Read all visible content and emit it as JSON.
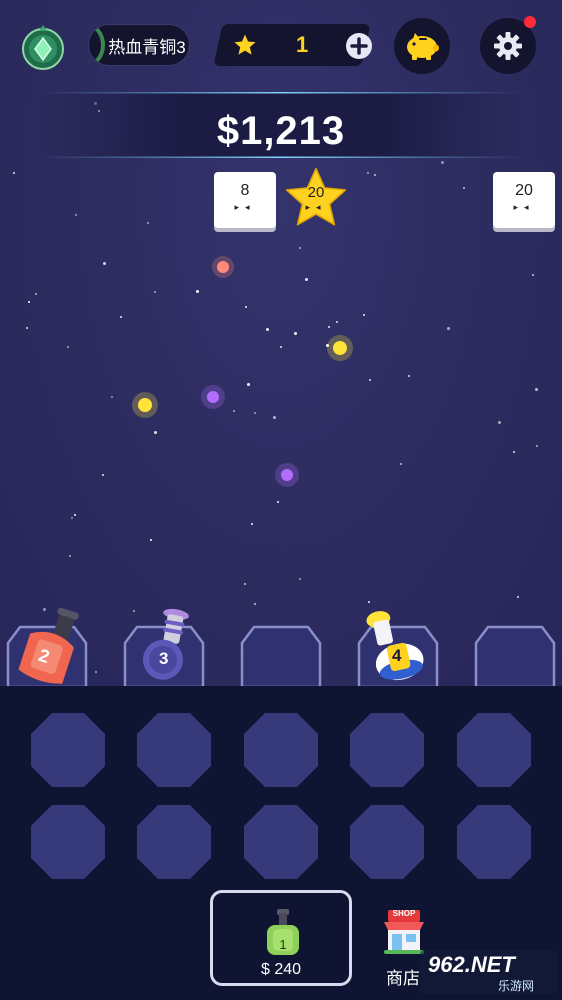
{
  "header": {
    "rank_label": "热血青铜3",
    "star_count": "1",
    "has_notification": true
  },
  "score": {
    "money": "$1,213"
  },
  "targets": [
    {
      "value": "8",
      "kind": "block"
    },
    {
      "value": "20",
      "kind": "star"
    },
    {
      "value": "20",
      "kind": "block"
    }
  ],
  "cannons": [
    {
      "level": "2",
      "color": "#f0664f"
    },
    {
      "level": "3",
      "color": "#5b58b8"
    },
    {
      "level": "",
      "color": ""
    },
    {
      "level": "4",
      "color": "#ffffff"
    },
    {
      "level": "",
      "color": ""
    }
  ],
  "shop": {
    "buy_cannon_level": "1",
    "buy_price": "$ 240",
    "shop_label": "商店",
    "shop_sign": "SHOP"
  },
  "watermark": {
    "text": "962.NET",
    "subtext": "乐游网"
  },
  "colors": {
    "space": "#2c2b5e",
    "tray": "#0f1432",
    "gold": "#ffd21f"
  }
}
